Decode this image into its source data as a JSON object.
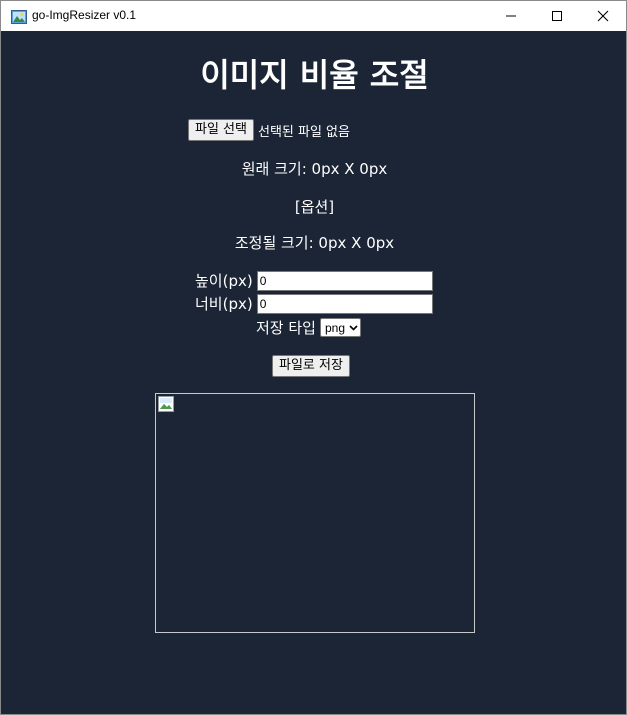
{
  "window": {
    "title": "go-ImgResizer v0.1",
    "icons": {
      "app": "image-icon",
      "minimize": "minimize-icon",
      "maximize": "maximize-icon",
      "close": "close-icon"
    }
  },
  "main": {
    "heading": "이미지 비율 조절",
    "file_button_label": "파일 선택",
    "file_status": "선택된 파일 없음",
    "original_size": "원래 크기: 0px X 0px",
    "options_label": "[옵션]",
    "adjusted_size": "조정될 크기: 0px X 0px",
    "height_label": "높이(px)",
    "height_value": "0",
    "width_label": "너비(px)",
    "width_value": "0",
    "save_type_label": "저장 타입",
    "save_type_selected": "png",
    "save_button_label": "파일로 저장",
    "preview_icon": "broken-image-icon"
  },
  "colors": {
    "background": "#1b2536",
    "text": "#ffffff",
    "titlebar": "#ffffff"
  }
}
